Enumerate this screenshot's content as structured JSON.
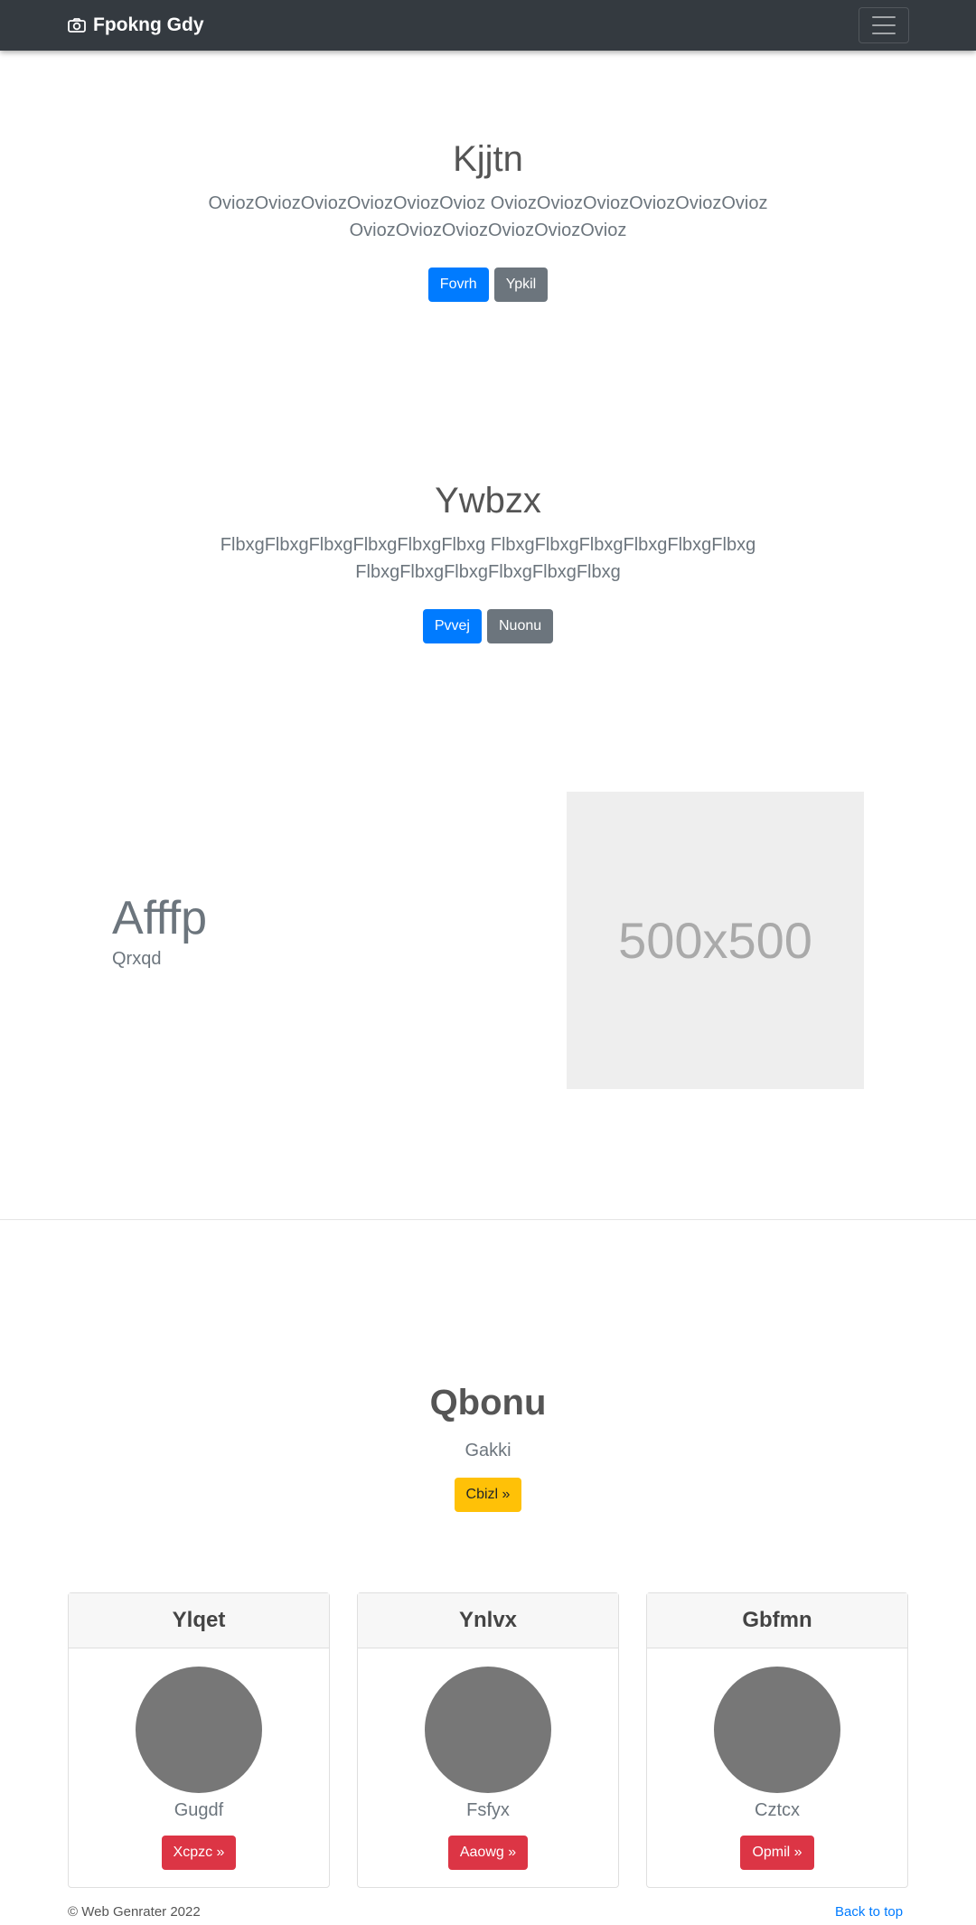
{
  "navbar": {
    "brand": "Fpokng Gdy",
    "brand_icon": "camera-icon",
    "toggler_icon": "hamburger-icon"
  },
  "hero1": {
    "title": "Kjjtn",
    "text": "OviozOviozOviozOviozOviozOvioz OviozOviozOviozOviozOviozOvioz OviozOviozOviozOviozOviozOvioz",
    "primary_label": "Fovrh",
    "secondary_label": "Ypkil"
  },
  "hero2": {
    "title": "Ywbzx",
    "text": "FlbxgFlbxgFlbxgFlbxgFlbxgFlbxg FlbxgFlbxgFlbxgFlbxgFlbxgFlbxg FlbxgFlbxgFlbxgFlbxgFlbxgFlbxg",
    "primary_label": "Pvvej",
    "secondary_label": "Nuonu"
  },
  "feature": {
    "title": "Afffp",
    "subtitle": "Qrxqd",
    "placeholder_text": "500x500"
  },
  "cta": {
    "title": "Qbonu",
    "subtitle": "Gakki",
    "button_label": "Cbizl »"
  },
  "cards": [
    {
      "header": "Ylqet",
      "text": "Gugdf",
      "button_label": "Xcpzc »"
    },
    {
      "header": "Ynlvx",
      "text": "Fsfyx",
      "button_label": "Aaowg »"
    },
    {
      "header": "Gbfmn",
      "text": "Cztcx",
      "button_label": "Opmil »"
    }
  ],
  "footer": {
    "copyright": "© Web Genrater 2022",
    "back_to_top": "Back to top"
  },
  "colors": {
    "navbar": "#343a40",
    "primary": "#007bff",
    "secondary": "#6c757d",
    "warning": "#ffc107",
    "danger": "#dc3545"
  }
}
